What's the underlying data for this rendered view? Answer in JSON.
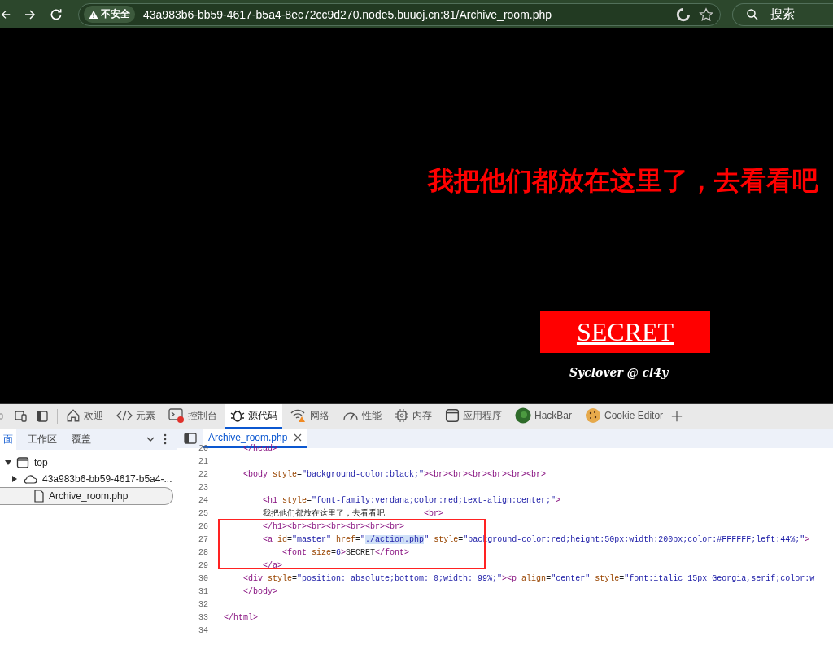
{
  "browser": {
    "security_label": "不安全",
    "url": "43a983b6-bb59-4617-b5a4-8ec72cc9d270.node5.buuoj.cn:81/Archive_room.php",
    "search_label": "搜索"
  },
  "page": {
    "heading": "我把他们都放在这里了，去看看吧",
    "link": "SECRET",
    "footer": "Syclover @ cl4y"
  },
  "devtools": {
    "tabs": [
      {
        "label": "欢迎",
        "selected": false
      },
      {
        "label": "元素",
        "selected": false
      },
      {
        "label": "控制台",
        "selected": false
      },
      {
        "label": "源代码",
        "selected": true
      },
      {
        "label": "网络",
        "selected": false
      },
      {
        "label": "性能",
        "selected": false
      },
      {
        "label": "内存",
        "selected": false
      },
      {
        "label": "应用程序",
        "selected": false
      },
      {
        "label": "HackBar",
        "selected": false
      },
      {
        "label": "Cookie Editor",
        "selected": false
      }
    ],
    "sidebar": {
      "tabs": [
        {
          "label": "面",
          "selected": true
        },
        {
          "label": "工作区",
          "selected": false
        },
        {
          "label": "覆盖",
          "selected": false
        }
      ],
      "tree": [
        {
          "label": "top",
          "kind": "frame",
          "selected": false,
          "expanded": true,
          "children": [
            {
              "label": "43a983b6-bb59-4617-b5a4-...",
              "kind": "origin",
              "selected": false,
              "expanded": false
            },
            {
              "label": "Archive_room.php",
              "kind": "file",
              "selected": true,
              "expanded": false
            }
          ]
        }
      ]
    },
    "editor": {
      "file_tab": "Archive_room.php",
      "lines": [
        {
          "number": "20",
          "tokens": [
            {
              "kind": "tag",
              "text": "    </head>"
            }
          ]
        },
        {
          "number": "21"
        },
        {
          "number": "22",
          "tokens": [
            {
              "kind": "tag",
              "text": "    <body"
            },
            {
              "kind": "attr",
              "text": " style"
            },
            {
              "kind": "text",
              "text": "="
            },
            {
              "kind": "value",
              "text": "\"background-color:black;\""
            },
            {
              "kind": "tag",
              "text": "><br><br><br><br><br><br>"
            }
          ]
        },
        {
          "number": "23"
        },
        {
          "number": "24",
          "tokens": [
            {
              "kind": "tag",
              "text": "        <h1"
            },
            {
              "kind": "attr",
              "text": " style"
            },
            {
              "kind": "text",
              "text": "="
            },
            {
              "kind": "value",
              "text": "\"font-family:verdana;color:red;text-align:center;\""
            },
            {
              "kind": "tag",
              "text": ">"
            }
          ]
        },
        {
          "number": "25",
          "tokens": [
            {
              "kind": "text",
              "text": "        我把他们都放在这里了，去看看吧"
            },
            {
              "kind": "tag",
              "text": "        <br>"
            }
          ]
        },
        {
          "number": "26",
          "tokens": [
            {
              "kind": "tag",
              "text": "        </h1><br><br><br><br><br><br>"
            }
          ]
        },
        {
          "number": "27",
          "tokens": [
            {
              "kind": "tag",
              "text": "        <a"
            },
            {
              "kind": "attr",
              "text": " id"
            },
            {
              "kind": "text",
              "text": "="
            },
            {
              "kind": "value",
              "text": "\"master\""
            },
            {
              "kind": "attr",
              "text": " href"
            },
            {
              "kind": "text",
              "text": "="
            },
            {
              "kind": "value",
              "text": "\""
            },
            {
              "kind": "selection",
              "text": "./action.php"
            },
            {
              "kind": "value",
              "text": "\""
            },
            {
              "kind": "attr",
              "text": " style"
            },
            {
              "kind": "text",
              "text": "="
            },
            {
              "kind": "value",
              "text": "\"background-color:red;height:50px;width:200px;color:#FFFFFF;left:44%;\""
            },
            {
              "kind": "tag",
              "text": ">"
            }
          ]
        },
        {
          "number": "28",
          "tokens": [
            {
              "kind": "tag",
              "text": "            <font"
            },
            {
              "kind": "attr",
              "text": " size"
            },
            {
              "kind": "text",
              "text": "="
            },
            {
              "kind": "value",
              "text": "6"
            },
            {
              "kind": "tag",
              "text": ">"
            },
            {
              "kind": "text",
              "text": "SECRET"
            },
            {
              "kind": "tag",
              "text": "</font>"
            }
          ]
        },
        {
          "number": "29",
          "tokens": [
            {
              "kind": "tag",
              "text": "        </a>"
            }
          ]
        },
        {
          "number": "30",
          "tokens": [
            {
              "kind": "tag",
              "text": "    <div"
            },
            {
              "kind": "attr",
              "text": " style"
            },
            {
              "kind": "text",
              "text": "="
            },
            {
              "kind": "value",
              "text": "\"position: absolute;bottom: 0;width: 99%;\""
            },
            {
              "kind": "tag",
              "text": "><p"
            },
            {
              "kind": "attr",
              "text": " align"
            },
            {
              "kind": "text",
              "text": "="
            },
            {
              "kind": "value",
              "text": "\"center\""
            },
            {
              "kind": "attr",
              "text": " style"
            },
            {
              "kind": "text",
              "text": "="
            },
            {
              "kind": "value",
              "text": "\"font:italic 15px Georgia,serif;color:w"
            }
          ]
        },
        {
          "number": "31",
          "tokens": [
            {
              "kind": "tag",
              "text": "    </body>"
            }
          ]
        },
        {
          "number": "32"
        },
        {
          "number": "33",
          "tokens": [
            {
              "kind": "tag",
              "text": "</html>"
            }
          ]
        },
        {
          "number": "34"
        }
      ]
    }
  }
}
